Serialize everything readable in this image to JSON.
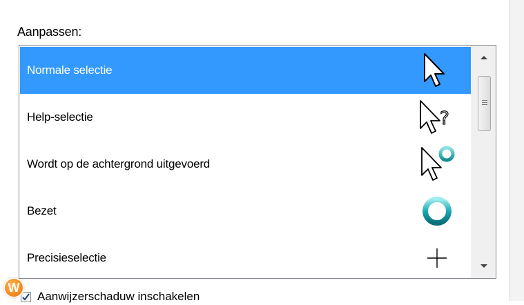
{
  "section": {
    "customize_label": "Aanpassen:"
  },
  "cursor_list": {
    "items": [
      {
        "label": "Normale selectie",
        "icon": "arrow-cursor-icon",
        "selected": true
      },
      {
        "label": "Help-selectie",
        "icon": "help-cursor-icon",
        "selected": false
      },
      {
        "label": "Wordt op de achtergrond uitgevoerd",
        "icon": "working-in-background-cursor-icon",
        "selected": false
      },
      {
        "label": "Bezet",
        "icon": "busy-cursor-icon",
        "selected": false
      },
      {
        "label": "Precisieselectie",
        "icon": "crosshair-cursor-icon",
        "selected": false
      }
    ]
  },
  "options": {
    "shadow_checkbox_label": "Aanwijzerschaduw inschakelen",
    "shadow_checked": true
  },
  "badge": {
    "letter": "W"
  },
  "colors": {
    "selection": "#3399ff",
    "busy_ring": "#1ba9b4"
  }
}
